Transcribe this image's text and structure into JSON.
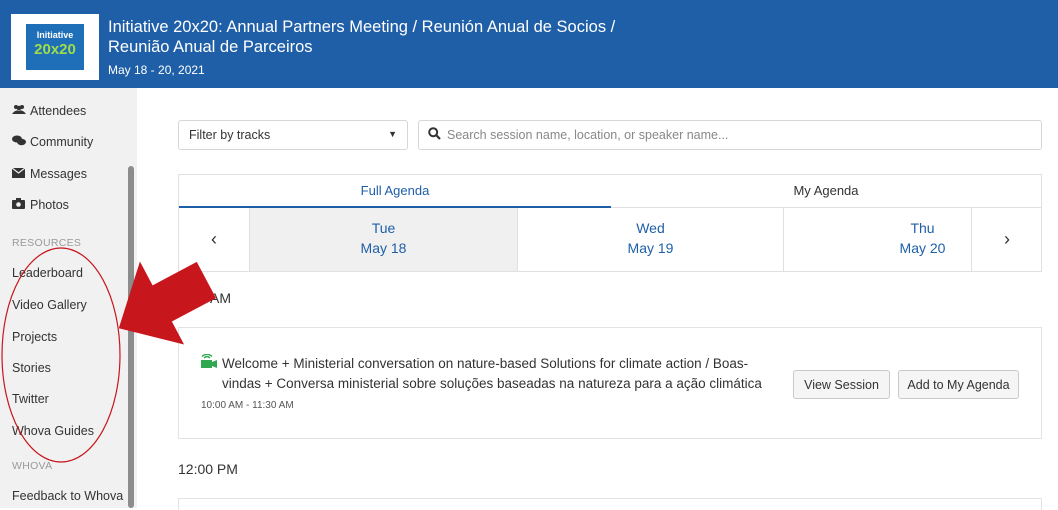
{
  "header": {
    "logo_top": "Initiative",
    "logo_bottom": "20x20",
    "title_line1": "Initiative 20x20: Annual Partners Meeting / Reunión Anual de Socios /",
    "title_line2": "Reunião Anual de Parceiros",
    "date": "May 18 - 20, 2021",
    "bg_color": "#1f5fa8"
  },
  "sidebar": {
    "items": [
      {
        "label": "Attendees",
        "icon": "users-icon"
      },
      {
        "label": "Community",
        "icon": "chat-icon"
      },
      {
        "label": "Messages",
        "icon": "envelope-icon"
      },
      {
        "label": "Photos",
        "icon": "camera-icon"
      }
    ],
    "resources_header": "RESOURCES",
    "resources": [
      "Leaderboard",
      "Video Gallery",
      "Projects",
      "Stories",
      "Twitter",
      "Whova Guides"
    ],
    "whova_header": "WHOVA",
    "whova_items": [
      "Feedback to Whova"
    ]
  },
  "filter": {
    "label": "Filter by tracks"
  },
  "search": {
    "placeholder": "Search session name, location, or speaker name..."
  },
  "tabs": [
    {
      "label": "Full Agenda",
      "active": true
    },
    {
      "label": "My Agenda",
      "active": false
    }
  ],
  "days": [
    {
      "weekday": "Tue",
      "date": "May 18",
      "selected": true
    },
    {
      "weekday": "Wed",
      "date": "May 19",
      "selected": false
    },
    {
      "weekday": "Thu",
      "date": "May 20",
      "selected": false
    }
  ],
  "times": {
    "first": "AM",
    "second": "12:00 PM"
  },
  "session": {
    "title_line1": "Welcome + Ministerial conversation on nature-based Solutions for climate action / Boas-",
    "title_line2": "vindas + Conversa ministerial sobre soluções baseadas na natureza para a ação climática",
    "time": "10:00 AM - 11:30 AM",
    "view_label": "View Session",
    "add_label": "Add to My Agenda",
    "icon": "live-stream-icon",
    "icon_color": "#2fa84f"
  },
  "annotation": {
    "arrow_color": "#c8161d",
    "ellipse_color": "#c8161d"
  }
}
